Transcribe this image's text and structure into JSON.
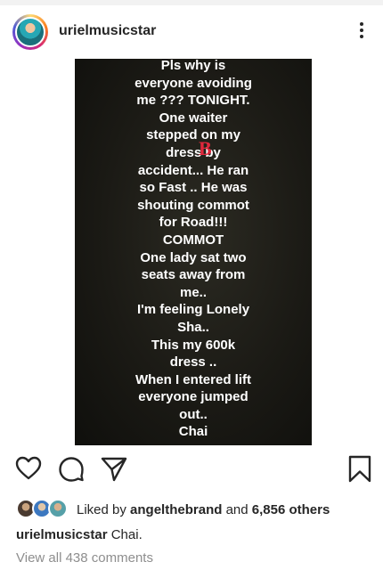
{
  "post": {
    "username": "urielmusicstar",
    "avatar_icon": "profile-avatar",
    "more_icon": "more-vertical-icon"
  },
  "story": {
    "lines": [
      "Pls why is",
      "everyone avoiding",
      "me ??? TONIGHT.",
      "One waiter",
      "stepped  on my",
      "dress by",
      "accident... He ran",
      "so Fast .. He was",
      "shouting commot",
      "for Road!!!",
      "COMMOT",
      "One lady sat two",
      "seats away from",
      "me..",
      "I'm feeling Lonely",
      "Sha..",
      "This my 600k",
      "dress ..",
      "When I entered lift",
      "everyone jumped",
      "out..",
      "Chai"
    ],
    "watermark": "B",
    "watermark_color": "#e0283c"
  },
  "actions": {
    "like_icon": "heart-icon",
    "comment_icon": "comment-icon",
    "share_icon": "send-icon",
    "save_icon": "bookmark-icon"
  },
  "likes": {
    "prefix": "Liked by ",
    "user": "angelthebrand",
    "connector": " and ",
    "others": "6,856 others"
  },
  "caption": {
    "username": "urielmusicstar",
    "text": " Chai."
  },
  "comments": {
    "view_all": "View all 438 comments"
  }
}
